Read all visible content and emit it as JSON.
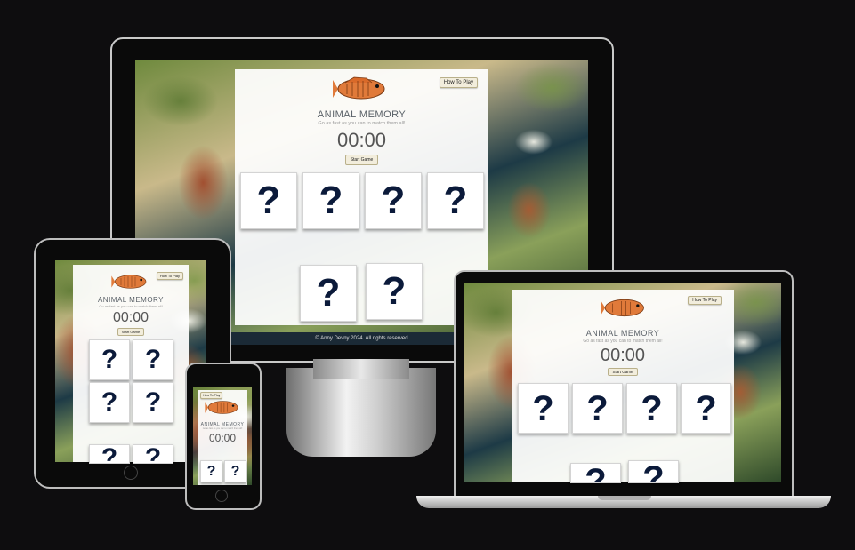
{
  "app": {
    "title": "ANIMAL MEMORY",
    "subtitle": "Go as fast as you can to match them all!",
    "timer": "00:00",
    "start_label": "Start Game",
    "howto_label": "How To Play",
    "card_face": "?",
    "footer": "© Anny Devny 2024. All rights reserved"
  },
  "devices": [
    "desktop",
    "laptop",
    "tablet",
    "phone"
  ],
  "colors": {
    "background": "#0e0d0f",
    "button": "#f2eddc",
    "card_mark": "#0b1a3a",
    "fish": "#e07a3a"
  }
}
